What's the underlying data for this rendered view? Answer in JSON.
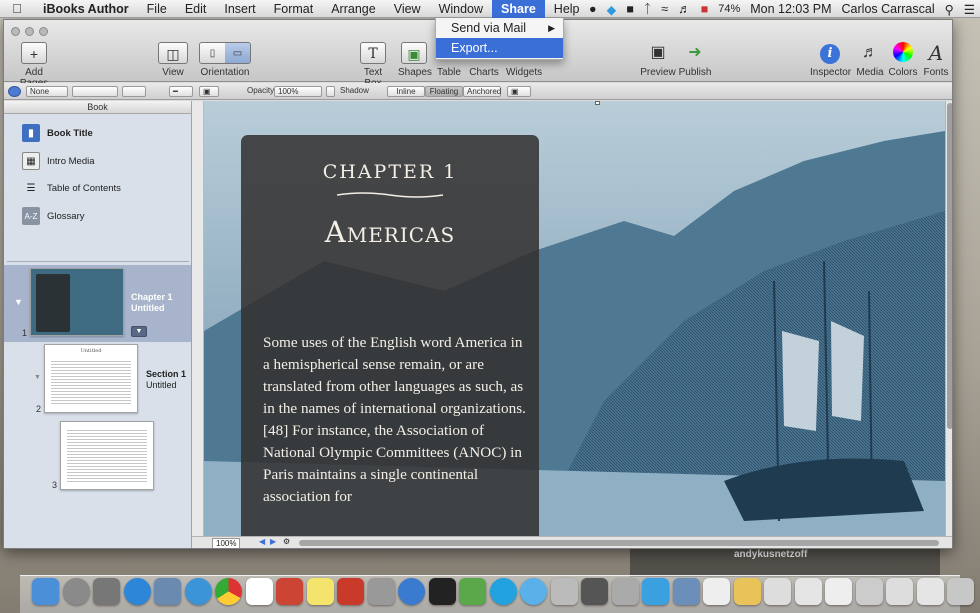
{
  "menubar": {
    "app_name": "iBooks Author",
    "items": [
      "File",
      "Edit",
      "Insert",
      "Format",
      "Arrange",
      "View",
      "Window",
      "Share",
      "Help"
    ],
    "battery": "74%",
    "clock": "Mon 12:03 PM",
    "user": "Carlos Carrascal"
  },
  "share_menu": {
    "items": [
      "Send via Mail",
      "Export..."
    ]
  },
  "toolbar": {
    "add_pages": "Add Pages",
    "view": "View",
    "orientation": "Orientation",
    "text_box": "Text Box",
    "shapes": "Shapes",
    "table": "Table",
    "charts": "Charts",
    "widgets": "Widgets",
    "preview": "Preview",
    "publish": "Publish",
    "inspector": "Inspector",
    "media": "Media",
    "colors": "Colors",
    "fonts": "Fonts"
  },
  "format_bar": {
    "style": "None",
    "opacity_label": "Opacity:",
    "opacity_value": "100%",
    "shadow": "Shadow",
    "wrap": [
      "Inline",
      "Floating",
      "Anchored"
    ]
  },
  "sidebar": {
    "header": "Book",
    "items": [
      "Book Title",
      "Intro Media",
      "Table of Contents",
      "Glossary"
    ],
    "pages": [
      {
        "num": "1",
        "title": "Chapter 1",
        "subtitle": "Untitled"
      },
      {
        "num": "2",
        "title": "Section 1",
        "subtitle": "Untitled"
      },
      {
        "num": "3"
      }
    ],
    "thumb2_title": "Untitled"
  },
  "canvas": {
    "chapter": "CHAPTER 1",
    "title": "Americas",
    "body": "Some uses of the English word America in a hemispherical sense remain, or are translated from other languages as such, as in the names of international organizations.[48] For instance, the Association of National Olympic Committees (ANOC) in Paris maintains a single continental association for"
  },
  "status": {
    "zoom": "100%"
  },
  "background": {
    "tweet_user": "andykusnetzoff"
  },
  "colors": {
    "menu_highlight": "#3b6fd8",
    "sidebar": "#d9e0ea",
    "page_selected": "#a7b4cc",
    "panel": "#32302e",
    "engraving": "#2e5772"
  }
}
